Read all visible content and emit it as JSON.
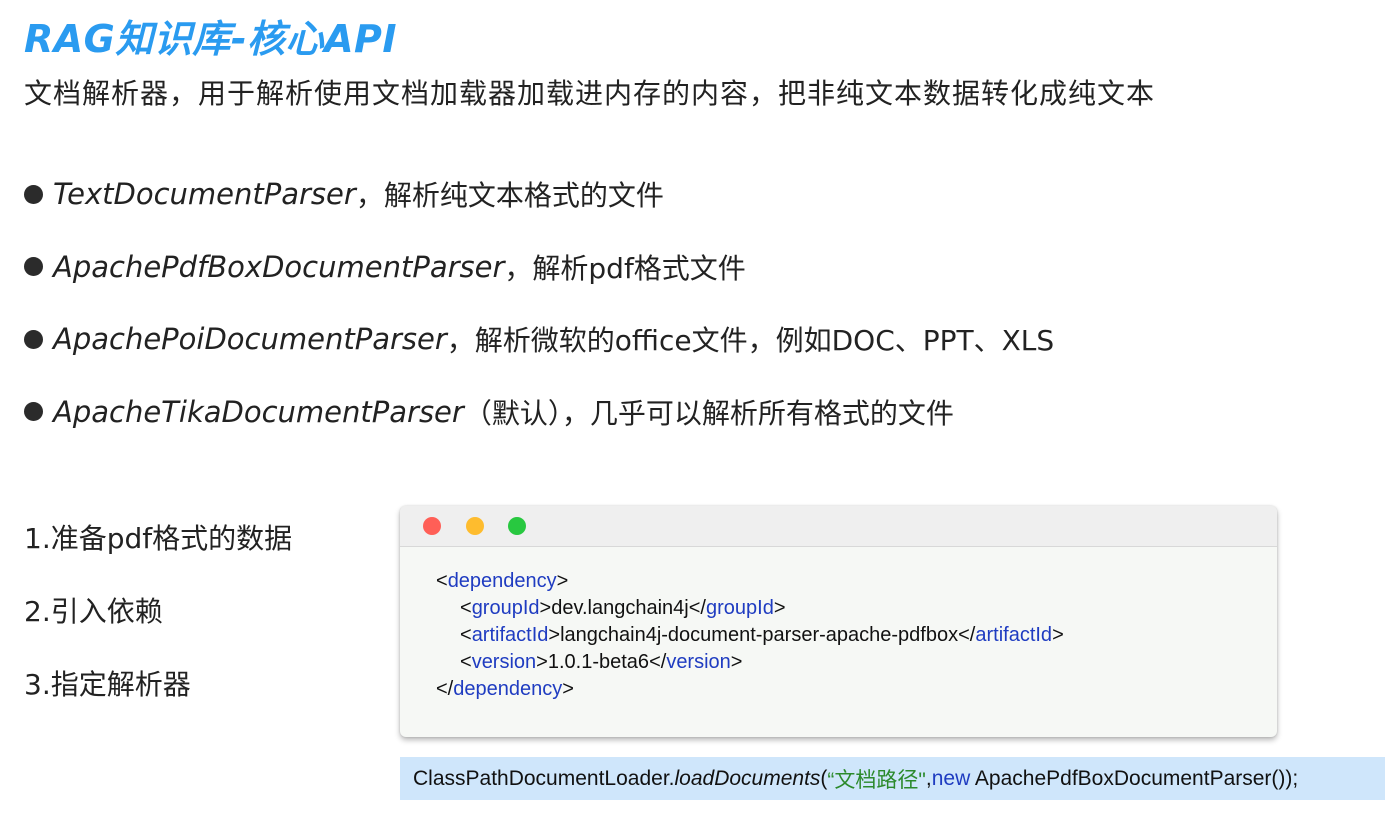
{
  "title": "RAG知识库-核心API",
  "subtitle": "文档解析器，用于解析使用文档加载器加载进内存的内容，把非纯文本数据转化成纯文本",
  "bullets": [
    {
      "name": "TextDocumentParser",
      "desc": "，解析纯文本格式的文件"
    },
    {
      "name": "ApachePdfBoxDocumentParser",
      "desc": "，解析pdf格式文件"
    },
    {
      "name": "ApachePoiDocumentParser",
      "desc": "，解析微软的office文件，例如DOC、PPT、XLS"
    },
    {
      "name": "ApacheTikaDocumentParser",
      "desc": "（默认），几乎可以解析所有格式的文件"
    }
  ],
  "steps": [
    "1.准备pdf格式的数据",
    "2.引入依赖",
    "3.指定解析器"
  ],
  "code": {
    "dependency_tag": "dependency",
    "groupId_tag": "groupId",
    "groupId_value": "dev.langchain4j",
    "artifactId_tag": "artifactId",
    "artifactId_value": "langchain4j-document-parser-apache-pdfbox",
    "version_tag": "version",
    "version_value": "1.0.1-beta6"
  },
  "call": {
    "class": "ClassPathDocumentLoader.",
    "method": "loadDocuments",
    "open": "(",
    "string": "“文档路径\"",
    "comma": ",",
    "keyword": "new",
    "rest": " ApachePdfBoxDocumentParser());"
  }
}
